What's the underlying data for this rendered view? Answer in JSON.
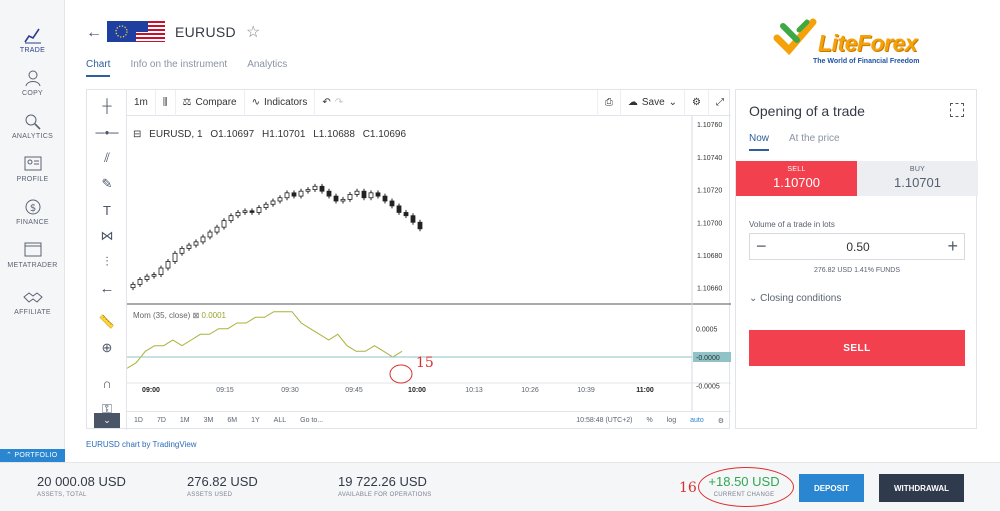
{
  "nav": [
    {
      "label": "TRADE",
      "icon": "trade-icon"
    },
    {
      "label": "COPY",
      "icon": "copy-icon"
    },
    {
      "label": "ANALYTICS",
      "icon": "analytics-icon"
    },
    {
      "label": "PROFILE",
      "icon": "profile-icon"
    },
    {
      "label": "FINANCE",
      "icon": "finance-icon"
    },
    {
      "label": "METATRADER",
      "icon": "metatrader-icon"
    },
    {
      "label": "AFFILIATE",
      "icon": "affiliate-icon"
    }
  ],
  "portfolio_label": "PORTFOLIO",
  "header": {
    "symbol": "EURUSD",
    "tabs": [
      "Chart",
      "Info on the instrument",
      "Analytics"
    ]
  },
  "toolbar": {
    "interval": "1m",
    "compare": "Compare",
    "indicators": "Indicators",
    "save": "Save"
  },
  "legend": {
    "symbol": "EURUSD, 1",
    "open": "O1.10697",
    "high": "H1.10701",
    "low": "L1.10688",
    "close": "C1.10696"
  },
  "momentum": {
    "label": "Mom (35, close)",
    "value": "0.0001"
  },
  "price_axis": [
    "1.10760",
    "1.10740",
    "1.10720",
    "1.10700",
    "1.10680",
    "1.10660"
  ],
  "mom_axis": [
    "0.0005",
    "-0.0000",
    "-0.0005"
  ],
  "time_axis": [
    "09:00",
    "09:15",
    "09:30",
    "09:45",
    "10:00",
    "10:13",
    "10:26",
    "10:39",
    "11:00"
  ],
  "bottom_bar": {
    "ranges": [
      "1D",
      "7D",
      "1M",
      "3M",
      "6M",
      "1Y",
      "ALL"
    ],
    "goto": "Go to...",
    "clock": "10:58:48 (UTC+2)",
    "pct": "%",
    "log": "log",
    "auto": "auto"
  },
  "tv_credit": "EURUSD chart by TradingView",
  "logo": {
    "name": "LiteForex",
    "tagline": "The World of Financial Freedom"
  },
  "trade_panel": {
    "title": "Opening of a trade",
    "mode_tabs": [
      "Now",
      "At the price"
    ],
    "sell_label": "SELL",
    "sell_price": "1.10700",
    "buy_label": "BUY",
    "buy_price": "1.10701",
    "volume_label": "Volume of a trade in lots",
    "volume": "0.50",
    "funds": "276.82 USD   1.41% FUNDS",
    "closing_conditions": "Closing conditions",
    "sell_button": "SELL"
  },
  "footer": {
    "assets_total_value": "20 000.08 USD",
    "assets_total_label": "ASSETS, TOTAL",
    "assets_used_value": "276.82 USD",
    "assets_used_label": "ASSETS USED",
    "available_value": "19 722.26 USD",
    "available_label": "AVAILABLE FOR OPERATIONS",
    "change_value": "+18.50 USD",
    "change_label": "CURRENT CHANGE",
    "deposit": "DEPOSIT",
    "withdrawal": "WITHDRAWAL"
  },
  "annotations": [
    "15",
    "16"
  ],
  "colors": {
    "sell": "#f2404f",
    "deposit": "#2a86d1",
    "withdraw": "#2f3a4d",
    "positive": "#2fa84f",
    "annotation": "#d93030"
  },
  "chart_data": {
    "type": "candlestick",
    "price_range": [
      1.1065,
      1.10765
    ],
    "candles": [
      1.10662,
      1.10665,
      1.10667,
      1.10668,
      1.10672,
      1.10676,
      1.10681,
      1.10684,
      1.10686,
      1.10688,
      1.10691,
      1.10694,
      1.10697,
      1.10701,
      1.10704,
      1.10706,
      1.10707,
      1.10706,
      1.10709,
      1.10711,
      1.10713,
      1.10715,
      1.10718,
      1.10716,
      1.10719,
      1.1072,
      1.10722,
      1.10719,
      1.10716,
      1.10713,
      1.10714,
      1.10717,
      1.10719,
      1.10715,
      1.10718,
      1.10716,
      1.10713,
      1.1071,
      1.10706,
      1.10704,
      1.107,
      1.10696
    ],
    "momentum_range": [
      -0.0006,
      0.0009
    ],
    "momentum": [
      -0.0002,
      -0.0001,
      0.0001,
      0.0002,
      0.0002,
      0.0003,
      0.0002,
      0.0003,
      0.0004,
      0.0004,
      0.0005,
      0.0005,
      0.0006,
      0.0006,
      0.0007,
      0.0007,
      0.0008,
      0.0008,
      0.0008,
      0.0006,
      0.0005,
      0.0004,
      0.0003,
      0.0004,
      0.0002,
      0.0001,
      0.0001,
      0.0002,
      0.0001,
      -0.0,
      0.0001
    ]
  }
}
